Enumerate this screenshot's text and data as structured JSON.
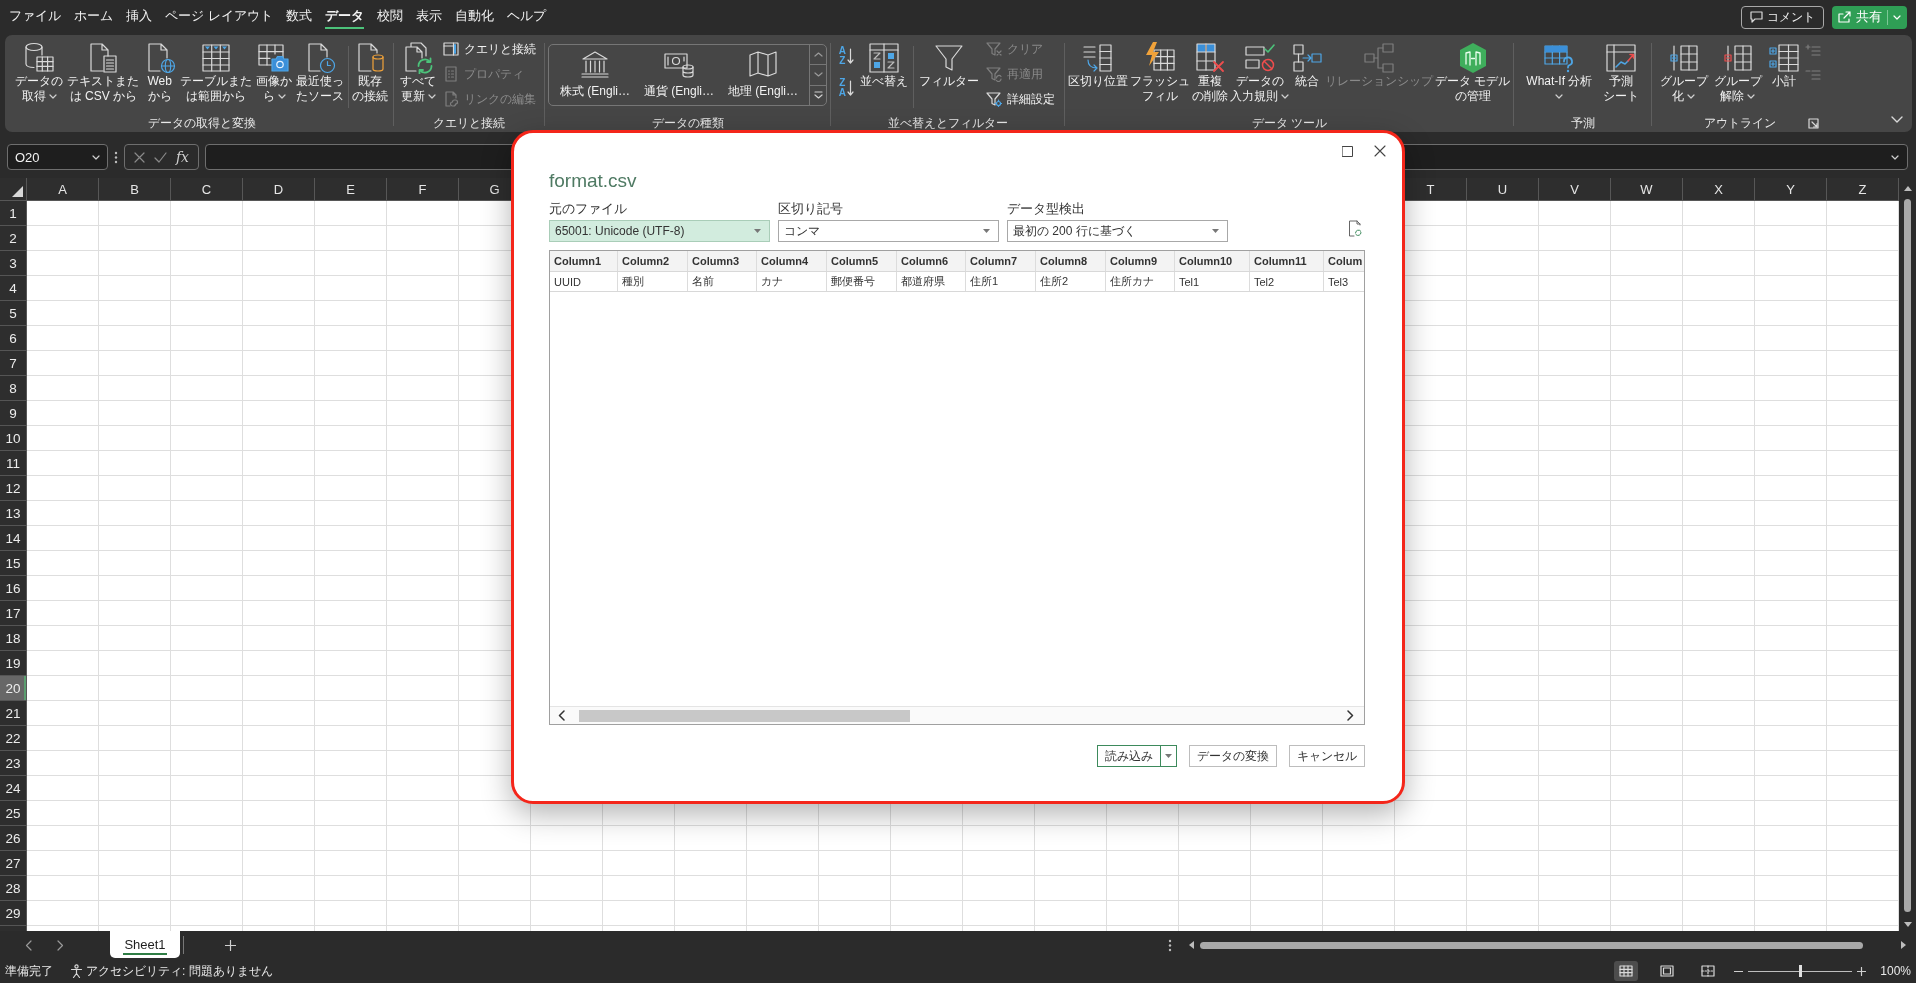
{
  "menu_tabs": [
    {
      "label": "ファイル",
      "selected": false
    },
    {
      "label": "ホーム",
      "selected": false
    },
    {
      "label": "挿入",
      "selected": false
    },
    {
      "label": "ページ レイアウト",
      "selected": false
    },
    {
      "label": "数式",
      "selected": false
    },
    {
      "label": "データ",
      "selected": true
    },
    {
      "label": "校閲",
      "selected": false
    },
    {
      "label": "表示",
      "selected": false
    },
    {
      "label": "自動化",
      "selected": false
    },
    {
      "label": "ヘルプ",
      "selected": false
    }
  ],
  "header_buttons": [
    {
      "kind": "comment",
      "label": "コメント"
    },
    {
      "kind": "share",
      "label": "共有"
    }
  ],
  "ribbon": {
    "groups": [
      {
        "label": "データの取得と変換",
        "launcher": false,
        "items": [
          {
            "kind": "large",
            "lines": [
              "データの",
              "取得"
            ],
            "dropdown": true,
            "disabled": false
          },
          {
            "kind": "large",
            "lines": [
              "テキストまた",
              "は CSV から"
            ],
            "dropdown": false,
            "disabled": false
          },
          {
            "kind": "large",
            "lines": [
              "Web",
              "から"
            ],
            "dropdown": false,
            "disabled": false
          },
          {
            "kind": "large",
            "lines": [
              "テーブルまた",
              "は範囲から"
            ],
            "dropdown": false,
            "disabled": false
          },
          {
            "kind": "large",
            "lines": [
              "画像か",
              "ら"
            ],
            "dropdown": true,
            "disabled": false
          },
          {
            "kind": "large",
            "lines": [
              "最近使っ",
              "たソース"
            ],
            "dropdown": false,
            "disabled": false
          },
          {
            "kind": "separator"
          },
          {
            "kind": "large",
            "lines": [
              "既存",
              "の接続"
            ],
            "dropdown": false,
            "disabled": false
          }
        ]
      },
      {
        "label": "クエリと接続",
        "launcher": false,
        "items": [
          {
            "kind": "large",
            "lines": [
              "すべて",
              "更新"
            ],
            "dropdown": true,
            "disabled": false
          },
          {
            "kind": "stack",
            "entries": [
              {
                "label": "クエリと接続",
                "disabled": false
              },
              {
                "label": "プロパティ",
                "disabled": true
              },
              {
                "label": "リンクの編集",
                "disabled": true
              }
            ]
          }
        ]
      },
      {
        "label": "データの種類",
        "launcher": false,
        "items": [
          {
            "kind": "gallery",
            "entries": [
              {
                "label": "株式 (Engli…"
              },
              {
                "label": "通貨 (Engli…"
              },
              {
                "label": "地理 (Engli…"
              }
            ]
          }
        ]
      },
      {
        "label": "並べ替えとフィルター",
        "launcher": false,
        "items": [
          {
            "kind": "sort_pair",
            "entries": [
              {
                "top": "A",
                "bottom": "Z"
              },
              {
                "top": "Z",
                "bottom": "A"
              }
            ]
          },
          {
            "kind": "large",
            "lines": [
              "並べ替え"
            ],
            "dropdown": false,
            "disabled": false
          },
          {
            "kind": "separator"
          },
          {
            "kind": "large",
            "lines": [
              "フィルター"
            ],
            "dropdown": false,
            "disabled": false
          },
          {
            "kind": "stack",
            "entries": [
              {
                "label": "クリア",
                "disabled": true
              },
              {
                "label": "再適用",
                "disabled": true
              },
              {
                "label": "詳細設定",
                "disabled": false
              }
            ]
          }
        ]
      },
      {
        "label": "データ ツール",
        "launcher": false,
        "items": [
          {
            "kind": "large",
            "lines": [
              "区切り位置"
            ],
            "dropdown": false,
            "disabled": false
          },
          {
            "kind": "large",
            "lines": [
              "フラッシュ",
              "フィル"
            ],
            "dropdown": false,
            "disabled": false
          },
          {
            "kind": "large",
            "lines": [
              "重複",
              "の削除"
            ],
            "dropdown": false,
            "disabled": false
          },
          {
            "kind": "large",
            "lines": [
              "データの",
              "入力規則"
            ],
            "dropdown": true,
            "disabled": false
          },
          {
            "kind": "large",
            "lines": [
              "統合"
            ],
            "dropdown": false,
            "disabled": false
          },
          {
            "kind": "large",
            "lines": [
              "リレーションシップ"
            ],
            "dropdown": false,
            "disabled": true
          },
          {
            "kind": "large",
            "lines": [
              "データ モデル",
              "の管理"
            ],
            "dropdown": false,
            "disabled": false
          }
        ]
      },
      {
        "label": "予測",
        "launcher": false,
        "items": [
          {
            "kind": "large",
            "lines": [
              "What-If 分析"
            ],
            "dropdown": true,
            "disabled": false
          },
          {
            "kind": "large",
            "lines": [
              "予測",
              "シート"
            ],
            "dropdown": false,
            "disabled": false
          }
        ]
      },
      {
        "label": "アウトライン",
        "launcher": true,
        "items": [
          {
            "kind": "large",
            "lines": [
              "グループ",
              "化"
            ],
            "dropdown": true,
            "disabled": false
          },
          {
            "kind": "large",
            "lines": [
              "グループ",
              "解除"
            ],
            "dropdown": true,
            "disabled": false
          },
          {
            "kind": "large",
            "lines": [
              "小計"
            ],
            "dropdown": false,
            "disabled": false
          },
          {
            "kind": "icon_stack",
            "entries": [
              {
                "disabled": true
              },
              {
                "disabled": true
              }
            ]
          }
        ]
      }
    ]
  },
  "formula_bar": {
    "name_box": "O20",
    "function_label": "fx"
  },
  "sheet": {
    "columns_left": [
      "A",
      "B",
      "C",
      "D",
      "E",
      "F",
      "G"
    ],
    "columns_right": [
      "T",
      "U",
      "V",
      "W",
      "X",
      "Y",
      "Z"
    ],
    "rows": [
      {
        "label": "1",
        "selected": false
      },
      {
        "label": "2",
        "selected": false
      },
      {
        "label": "3",
        "selected": false
      },
      {
        "label": "4",
        "selected": false
      },
      {
        "label": "5",
        "selected": false
      },
      {
        "label": "6",
        "selected": false
      },
      {
        "label": "7",
        "selected": false
      },
      {
        "label": "8",
        "selected": false
      },
      {
        "label": "9",
        "selected": false
      },
      {
        "label": "10",
        "selected": false
      },
      {
        "label": "11",
        "selected": false
      },
      {
        "label": "12",
        "selected": false
      },
      {
        "label": "13",
        "selected": false
      },
      {
        "label": "14",
        "selected": false
      },
      {
        "label": "15",
        "selected": false
      },
      {
        "label": "16",
        "selected": false
      },
      {
        "label": "17",
        "selected": false
      },
      {
        "label": "18",
        "selected": false
      },
      {
        "label": "19",
        "selected": false
      },
      {
        "label": "20",
        "selected": true
      },
      {
        "label": "21",
        "selected": false
      },
      {
        "label": "22",
        "selected": false
      },
      {
        "label": "23",
        "selected": false
      },
      {
        "label": "24",
        "selected": false
      },
      {
        "label": "25",
        "selected": false
      },
      {
        "label": "26",
        "selected": false
      },
      {
        "label": "27",
        "selected": false
      },
      {
        "label": "28",
        "selected": false
      },
      {
        "label": "29",
        "selected": false
      }
    ]
  },
  "sheet_tabs": [
    {
      "label": "Sheet1",
      "selected": true
    }
  ],
  "status_bar": {
    "ready": "準備完了",
    "accessibility": "アクセシビリティ: 問題ありません",
    "views": [
      {
        "kind": "normal",
        "selected": true
      },
      {
        "kind": "page_layout",
        "selected": false
      },
      {
        "kind": "page_break",
        "selected": false
      }
    ],
    "zoom": {
      "level": 0.5,
      "reading": "100%"
    }
  },
  "dialog": {
    "title": "format.csv",
    "fields": [
      {
        "label": "元のファイル",
        "value": "65001: Unicode (UTF-8)",
        "highlighted": true
      },
      {
        "label": "区切り記号",
        "value": "コンマ",
        "highlighted": false
      },
      {
        "label": "データ型検出",
        "value": "最初の 200 行に基づく",
        "highlighted": false
      }
    ],
    "table": {
      "columns": [
        "Column1",
        "Column2",
        "Column3",
        "Column4",
        "Column5",
        "Column6",
        "Column7",
        "Column8",
        "Column9",
        "Column10",
        "Column11",
        "Colum"
      ],
      "rows": [
        [
          "UUID",
          "種別",
          "名前",
          "カナ",
          "郵便番号",
          "都道府県",
          "住所1",
          "住所2",
          "住所カナ",
          "Tel1",
          "Tel2",
          "Tel3"
        ]
      ]
    },
    "buttons": [
      {
        "kind": "split",
        "label": "読み込み",
        "default": true
      },
      {
        "kind": "plain",
        "label": "データの変換",
        "default": false
      },
      {
        "kind": "plain",
        "label": "キャンセル",
        "default": false
      }
    ]
  }
}
